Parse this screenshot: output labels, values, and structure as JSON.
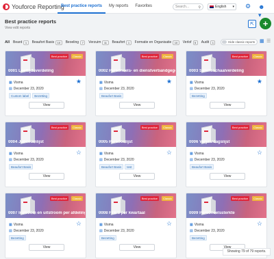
{
  "app": {
    "name": "Youforce Reporting"
  },
  "nav": {
    "tabs": [
      "Best practice reports",
      "My reports",
      "Favorites"
    ]
  },
  "search": {
    "placeholder": "Search..."
  },
  "language": {
    "selected": "English"
  },
  "page": {
    "title": "Best practice reports",
    "subtitle": "View edit reports"
  },
  "filters": {
    "all_label": "All",
    "items": [
      {
        "label": "Beard",
        "count": "1"
      },
      {
        "label": "Beaufort Basis",
        "count": "10"
      },
      {
        "label": "Beoeling",
        "count": "7"
      },
      {
        "label": "Verzuim",
        "count": "11"
      },
      {
        "label": "Beaufort",
        "count": "1"
      },
      {
        "label": "Formatie en Organisatie",
        "count": "10"
      },
      {
        "label": "Verlof",
        "count": "5"
      },
      {
        "label": "Audit",
        "count": "1"
      }
    ],
    "toggle_label": "Hide classic reports"
  },
  "cards": [
    {
      "title": "0001 Leeftijdsverdeling",
      "owner": "Visma",
      "date": "December 23, 2020",
      "tags": [
        "Custom label",
        "Bezetting"
      ],
      "starred": true,
      "badge_bp": "Best practice",
      "badge_classic": "Classic",
      "view": "View"
    },
    {
      "title": "0002 Personeels- en dienstverbandgegevens",
      "owner": "Visma",
      "date": "December 23, 2020",
      "tags": [
        "Beaufort Basis"
      ],
      "starred": true,
      "badge_bp": "Best practice",
      "badge_classic": "Classic",
      "view": "View"
    },
    {
      "title": "0003 Salarisschaalverdeling",
      "owner": "Visma",
      "date": "December 23, 2020",
      "tags": [
        "Bezetting"
      ],
      "starred": true,
      "badge_bp": "Best practice",
      "badge_classic": "Classic",
      "view": "View"
    },
    {
      "title": "0004 Jubileumlijst",
      "owner": "Visma",
      "date": "December 23, 2020",
      "tags": [
        "Beaufort Basis"
      ],
      "starred": false,
      "badge_bp": "Best practice",
      "badge_classic": "Classic",
      "view": "View"
    },
    {
      "title": "0005 Persoonlijst",
      "owner": "Visma",
      "date": "December 23, 2020",
      "tags": [
        "Beaufort Basis",
        "test"
      ],
      "starred": false,
      "badge_bp": "Best practice",
      "badge_classic": "Classic",
      "view": "View"
    },
    {
      "title": "0006 Verjaardagslijst",
      "owner": "Visma",
      "date": "December 23, 2020",
      "tags": [
        "Beaufort Basis"
      ],
      "starred": false,
      "badge_bp": "Best practice",
      "badge_classic": "Classic",
      "view": "View"
    },
    {
      "title": "0007 Instroom en uitstroom per afdeling",
      "owner": "Visma",
      "date": "December 23, 2020",
      "tags": [
        "Bezetting"
      ],
      "starred": false,
      "badge_bp": "Best practice",
      "badge_classic": "Classic",
      "view": "View"
    },
    {
      "title": "0008 FTE's per kwartaal",
      "owner": "Visma",
      "date": "December 23, 2020",
      "tags": [
        "Bezetting"
      ],
      "starred": false,
      "badge_bp": "Best practice",
      "badge_classic": "Classic",
      "view": "View"
    },
    {
      "title": "0009 Personeelssterkte",
      "owner": "Visma",
      "date": "December 23, 2020",
      "tags": [
        "Bezetting"
      ],
      "starred": false,
      "badge_bp": "Best practice",
      "badge_classic": "Classic",
      "view": "View"
    }
  ],
  "status": {
    "text": "Showing 79 of 79 reports."
  },
  "colors": {
    "accent": "#1b6fd1",
    "brand": "#e0263a",
    "add": "#1a8a2d"
  },
  "icons": {
    "search": "search-icon",
    "gear": "gear-icon",
    "user": "user-icon",
    "star": "star-icon",
    "share": "share-icon"
  }
}
